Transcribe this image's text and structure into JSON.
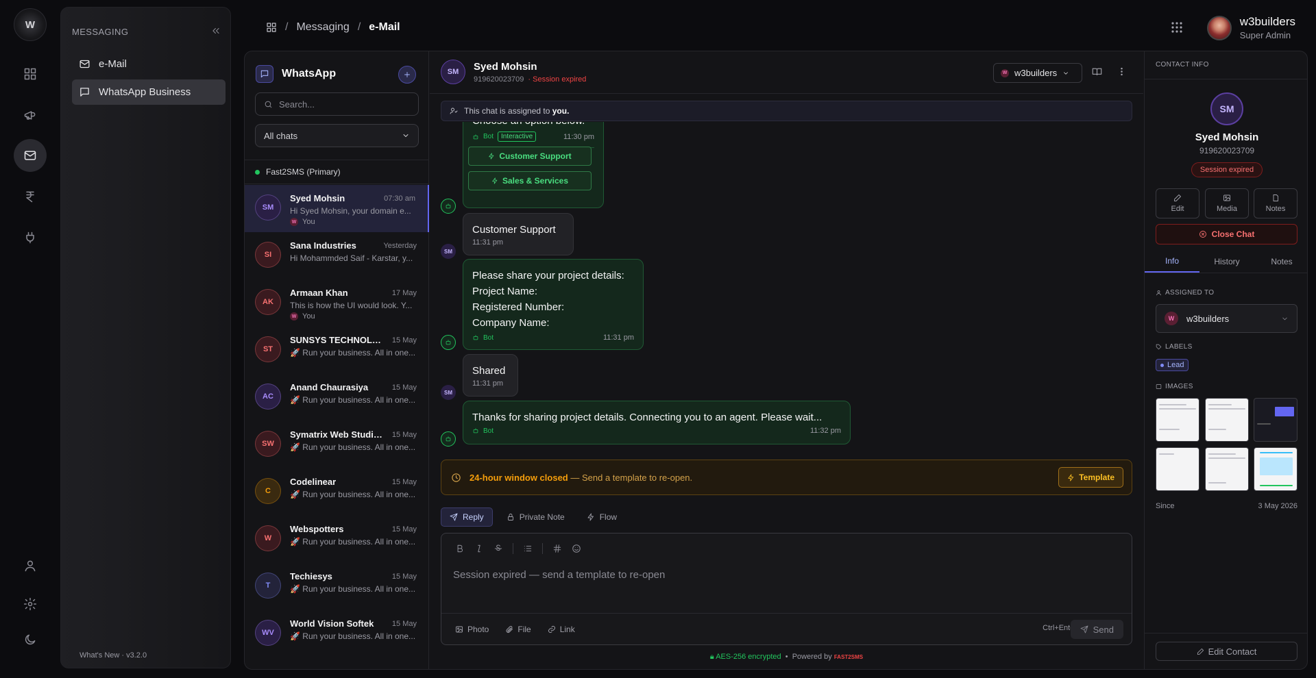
{
  "rail": {
    "logo": "W"
  },
  "nav": {
    "section_title": "MESSAGING",
    "items": [
      {
        "label": "e-Mail"
      },
      {
        "label": "WhatsApp Business"
      }
    ],
    "footer": "What's New · v3.2.0"
  },
  "breadcrumb": {
    "section": "Messaging",
    "current": "e-Mail"
  },
  "user": {
    "name": "w3builders",
    "role": "Super Admin"
  },
  "chatlist": {
    "title": "WhatsApp",
    "search_placeholder": "Search...",
    "filter": "All chats",
    "account": "Fast2SMS (Primary)",
    "conversations": [
      {
        "initials": "SM",
        "name": "Syed Mohsin",
        "time": "07:30 am",
        "preview": "Hi Syed Mohsin, your domain e...",
        "you": "You",
        "color": "#a78bfa",
        "bg": "#2a1f45"
      },
      {
        "initials": "SI",
        "name": "Sana Industries",
        "time": "Yesterday",
        "preview": "Hi Mohammded Saif - Karstar, y...",
        "you": "",
        "color": "#f87171",
        "bg": "#3a1a1f"
      },
      {
        "initials": "AK",
        "name": "Armaan Khan",
        "time": "17 May",
        "preview": "This is how the UI would look. Y...",
        "you": "You",
        "color": "#f87171",
        "bg": "#3a1a1f"
      },
      {
        "initials": "ST",
        "name": "SUNSYS TECHNOLOGIES",
        "time": "15 May",
        "preview": "🚀 Run your business. All in one...",
        "you": "",
        "color": "#f87171",
        "bg": "#3a1a1f"
      },
      {
        "initials": "AC",
        "name": "Anand Chaurasiya",
        "time": "15 May",
        "preview": "🚀 Run your business. All in one...",
        "you": "",
        "color": "#a78bfa",
        "bg": "#2a1f45"
      },
      {
        "initials": "SW",
        "name": "Symatrix Web Studio Pvt",
        "time": "15 May",
        "preview": "🚀 Run your business. All in one...",
        "you": "",
        "color": "#f87171",
        "bg": "#3a1a1f"
      },
      {
        "initials": "C",
        "name": "Codelinear",
        "time": "15 May",
        "preview": "🚀 Run your business. All in one...",
        "you": "",
        "color": "#f59e0b",
        "bg": "#3a2a10"
      },
      {
        "initials": "W",
        "name": "Webspotters",
        "time": "15 May",
        "preview": "🚀 Run your business. All in one...",
        "you": "",
        "color": "#f87171",
        "bg": "#3a1a1f"
      },
      {
        "initials": "T",
        "name": "Techiesys",
        "time": "15 May",
        "preview": "🚀 Run your business. All in one...",
        "you": "",
        "color": "#818cf8",
        "bg": "#23233a"
      },
      {
        "initials": "WV",
        "name": "World Vision Softek",
        "time": "15 May",
        "preview": "🚀 Run your business. All in one...",
        "you": "",
        "color": "#a78bfa",
        "bg": "#2a1f45"
      }
    ]
  },
  "chat": {
    "initials": "SM",
    "name": "Syed Mohsin",
    "number": "919620023709",
    "status": "· Session expired",
    "inbox": "w3builders",
    "assigned_prefix": "This chat is assigned to",
    "assigned_to": "you.",
    "messages": {
      "m1": {
        "text": "Choose an option below.",
        "bot": "Bot",
        "tag": "Interactive",
        "time": "11:30 pm",
        "btn1": "Customer Support",
        "btn2": "Sales & Services"
      },
      "m2": {
        "text": "Customer Support",
        "time": "11:31 pm"
      },
      "m3": {
        "line1": "Please share your project details:",
        "line2": "Project Name:",
        "line3": "Registered Number:",
        "line4": "Company Name:",
        "bot": "Bot",
        "time": "11:31 pm"
      },
      "m4": {
        "text": "Shared",
        "time": "11:31 pm"
      },
      "m5": {
        "text": "Thanks for sharing project details. Connecting you to an agent. Please wait...",
        "bot": "Bot",
        "time": "11:32 pm"
      }
    },
    "window_closed": "24-hour window closed",
    "window_msg": "— Send a template to re-open.",
    "template_btn": "Template",
    "tabs": {
      "reply": "Reply",
      "note": "Private Note",
      "flow": "Flow"
    },
    "composer_placeholder": "Session expired — send a template to re-open",
    "attach": {
      "photo": "Photo",
      "file": "File",
      "link": "Link"
    },
    "shortcut": "Ctrl+Enter",
    "send": "Send",
    "encryption": "AES-256 encrypted",
    "powered": "Powered by",
    "brand": "FAST2SMS"
  },
  "info": {
    "title": "CONTACT INFO",
    "initials": "SM",
    "name": "Syed Mohsin",
    "number": "919620023709",
    "status": "Session expired",
    "actions": {
      "edit": "Edit",
      "media": "Media",
      "notes": "Notes"
    },
    "close_chat": "Close Chat",
    "tabs": {
      "info": "Info",
      "history": "History",
      "notes": "Notes"
    },
    "assigned_label": "ASSIGNED TO",
    "assignee": "w3builders",
    "labels_label": "LABELS",
    "label": "Lead",
    "images_label": "IMAGES",
    "since_label": "Since",
    "since_value": "3 May 2026",
    "edit_contact": "Edit Contact"
  },
  "colors": {
    "accent": "#6366f1",
    "bot_green": "#22c55e",
    "warning": "#f59e0b",
    "danger": "#ef4444"
  }
}
